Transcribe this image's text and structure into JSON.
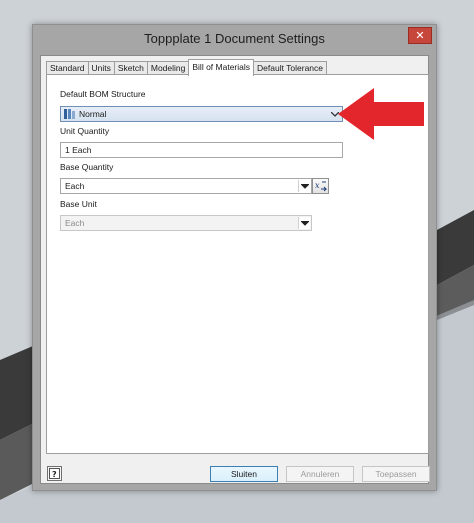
{
  "window": {
    "title": "Toppplate 1 Document Settings",
    "close_label": "✕"
  },
  "tabs": [
    {
      "label": "Standard",
      "active": false
    },
    {
      "label": "Units",
      "active": false
    },
    {
      "label": "Sketch",
      "active": false
    },
    {
      "label": "Modeling",
      "active": false
    },
    {
      "label": "Bill of Materials",
      "active": true
    },
    {
      "label": "Default Tolerance",
      "active": false
    }
  ],
  "form": {
    "bom_structure_label": "Default BOM Structure",
    "bom_structure_value": "Normal",
    "unit_quantity_label": "Unit Quantity",
    "unit_quantity_value": "1 Each",
    "base_quantity_label": "Base Quantity",
    "base_quantity_value": "Each",
    "base_unit_label": "Base Unit",
    "base_unit_value": "Each"
  },
  "buttons": {
    "close": "Sluiten",
    "cancel": "Annuleren",
    "apply": "Toepassen"
  },
  "icons": {
    "help": "help-icon",
    "bom": "bom-structure-icon",
    "fx": "function-icon"
  },
  "colors": {
    "accent": "#e3262b",
    "close_button": "#c7463c"
  }
}
